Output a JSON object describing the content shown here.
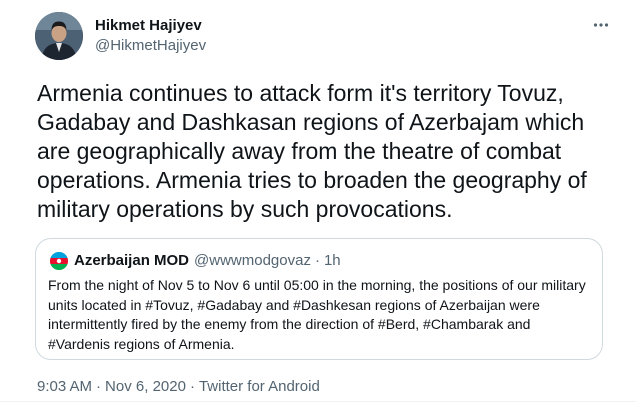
{
  "author": {
    "display_name": "Hikmet Hajiyev",
    "handle": "@HikmetHajiyev"
  },
  "tweet": {
    "text": "Armenia continues to attack form it's territory Tovuz, Gadabay and Dashkasan regions of Azerbajam which are geographically away from the theatre of combat operations. Armenia tries to broaden the geography of military operations by such provocations."
  },
  "quoted_tweet": {
    "display_name": "Azerbaijan MOD",
    "handle": "@wwwmodgovaz",
    "separator": "·",
    "time": "1h",
    "text": "From the night of Nov 5 to Nov 6 until 05:00 in the morning, the positions of our military units located in #Tovuz, #Gadabay and #Dashkesan regions of Azerbaijan were intermittently fired by the enemy from the direction of #Berd, #Chambarak and #Vardenis regions of Armenia."
  },
  "meta": {
    "time": "9:03 AM",
    "date": "Nov 6, 2020",
    "separator": "·",
    "source": "Twitter for Android"
  },
  "icons": {
    "more": "more-horizontal-icon",
    "author_avatar": "avatar",
    "quoted_avatar": "flag-avatar"
  },
  "colors": {
    "text_primary": "#0f1419",
    "text_secondary": "#536471",
    "border": "#cfd9de"
  }
}
